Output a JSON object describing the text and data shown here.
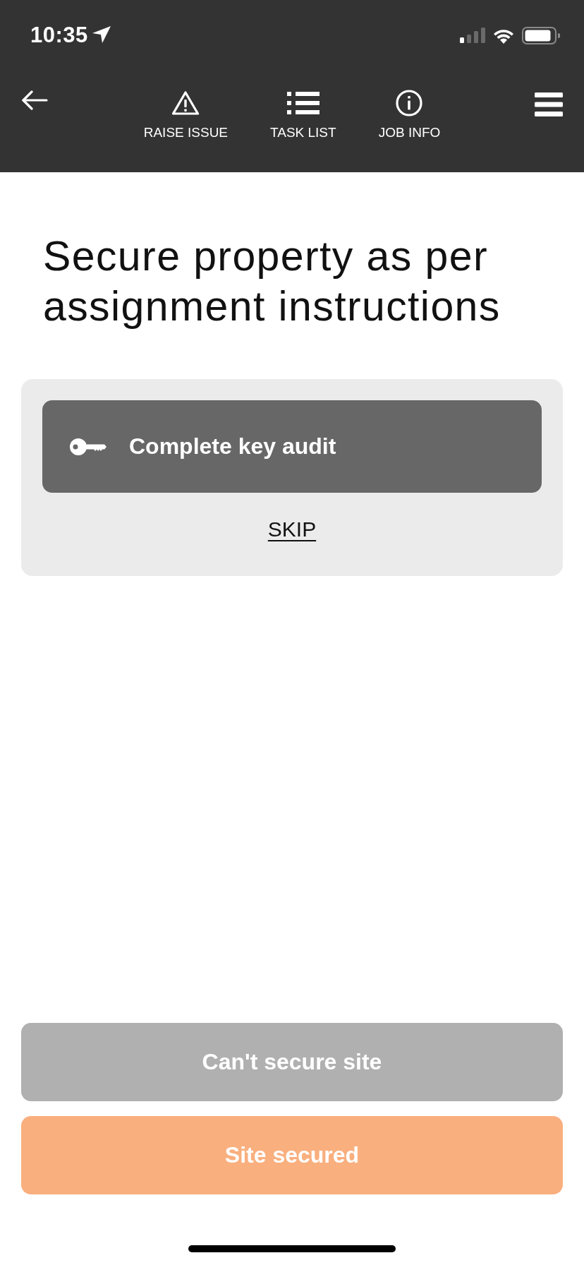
{
  "status_bar": {
    "time": "10:35"
  },
  "nav": {
    "items": [
      {
        "label": "RAISE ISSUE",
        "kind": "warning"
      },
      {
        "label": "TASK LIST",
        "kind": "list"
      },
      {
        "label": "JOB INFO",
        "kind": "info"
      }
    ]
  },
  "title": "Secure property as per assignment instructions",
  "task_card": {
    "task": {
      "label": "Complete key audit"
    },
    "skip": "SKIP"
  },
  "actions": [
    {
      "label": "Can't secure site",
      "kind": "secondary"
    },
    {
      "label": "Site secured",
      "kind": "primary"
    }
  ]
}
